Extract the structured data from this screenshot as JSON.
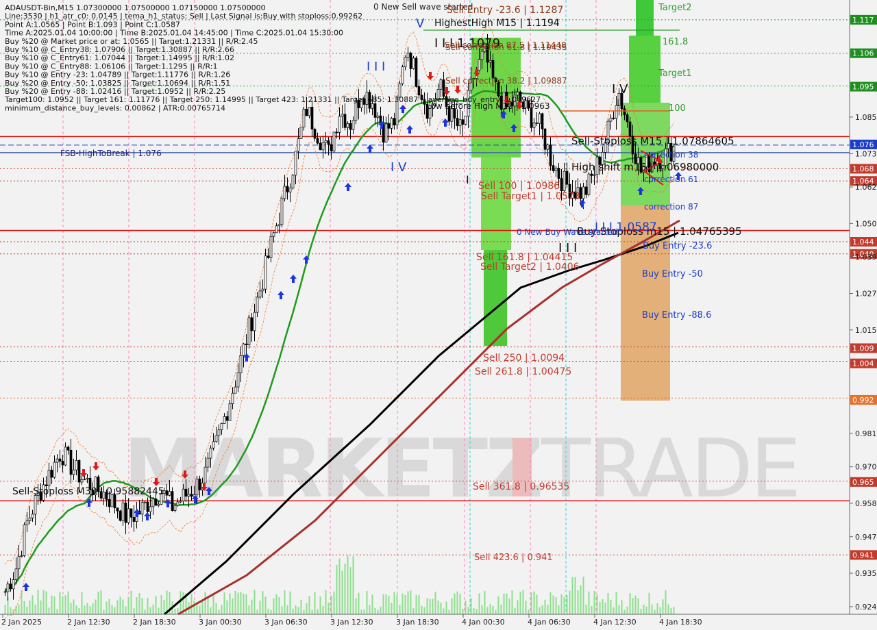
{
  "header": {
    "lines": [
      "ADAUSDT-Bin,M15  1.07300000 1.07500000 1.07150000 1.07500000",
      "Line:3530 | h1_atr_c0: 0.0145 | tema_h1_status: Sell | Last Signal is:Buy with stoploss:0.99262",
      "Point A:1.0565 | Point B:1.093 | Point C:1.0587",
      "Time A:2025.01.04 10:00:00 | Time B:2025.01.04 14:45:00 | Time C:2025.01.04 15:30:00",
      "Buy %20 @ Market price or at: 1.0565 || Target:1.21331 || R/R:2.45",
      "Buy %10 @ C_Entry38: 1.07906 || Target:1.30887 || R/R:2.66",
      "Buy %10 @ C_Entry61: 1.07044 || Target:1.14995 || R/R:1.02",
      "Buy %10 @ C_Entry88: 1.06106 || Target:1.1295 || R/R:1",
      "Buy %10 @ Entry -23: 1.04789 || Target:1.11776 || R/R:1.26",
      "Buy %20 @ Entry -50: 1.03825 || Target:1.10694 || R/R:1.51",
      "Buy %20 @ Entry -88: 1.02416 || Target:1.0952 || R/R:2.25",
      "Target100: 1.0952 || Target 161: 1.11776 || Target 250: 1.14995 || Target 423: 1.21331 || Target 685: 1.30887 || average_buy_entry: 1.049627",
      "minimum_distance_buy_levels: 0.00862 | ATR:0.00765714"
    ]
  },
  "watermark": {
    "left": "MARKETZ",
    "right": "TRADE"
  },
  "chart_data": {
    "type": "candlestick",
    "symbol": "ADAUSDT-Bin",
    "timeframe": "M15",
    "ylim": [
      0.9215,
      1.1235
    ],
    "y_ticks": [
      "1.117",
      "1.106",
      "1.095",
      "1.085",
      "1.076",
      "1.073",
      "1.068",
      "1.064",
      "1.062",
      "1.050",
      "1.044",
      "1.040",
      "1.039",
      "1.027",
      "1.015",
      "1.009",
      "1.004",
      "0.992",
      "0.981",
      "0.970",
      "0.965",
      "0.958",
      "0.947",
      "0.941",
      "0.935",
      "0.924"
    ],
    "highlighted_ticks": [
      {
        "label": "1.117",
        "color": "#1e8f1e"
      },
      {
        "label": "1.106",
        "color": "#1e8f1e"
      },
      {
        "label": "1.095",
        "color": "#1e8f1e"
      },
      {
        "label": "1.076",
        "color": "#1a3ecc"
      },
      {
        "label": "1.068",
        "color": "#c23b2c"
      },
      {
        "label": "1.064",
        "color": "#c23b2c"
      },
      {
        "label": "1.044",
        "color": "#c23b2c"
      },
      {
        "label": "1.040",
        "color": "#c23b2c"
      },
      {
        "label": "1.009",
        "color": "#c23b2c"
      },
      {
        "label": "1.004",
        "color": "#c23b2c"
      },
      {
        "label": "0.992",
        "color": "#e8702a"
      },
      {
        "label": "0.965",
        "color": "#c23b2c"
      },
      {
        "label": "0.941",
        "color": "#c23b2c"
      }
    ],
    "x_ticks": [
      "2 Jan 2025",
      "2 Jan 12:30",
      "2 Jan 18:30",
      "3 Jan 00:30",
      "3 Jan 06:30",
      "3 Jan 12:30",
      "3 Jan 18:30",
      "4 Jan 00:30",
      "4 Jan 06:30",
      "4 Jan 12:30",
      "4 Jan 18:30"
    ],
    "price_path": [
      0.929,
      0.937,
      0.952,
      0.961,
      0.968,
      0.975,
      0.97,
      0.966,
      0.963,
      0.961,
      0.957,
      0.953,
      0.955,
      0.959,
      0.962,
      0.957,
      0.96,
      0.963,
      0.968,
      0.978,
      0.99,
      1.003,
      1.017,
      1.03,
      1.045,
      1.058,
      1.071,
      1.088,
      1.08,
      1.073,
      1.087,
      1.083,
      1.094,
      1.09,
      1.08,
      1.084,
      1.109,
      1.097,
      1.087,
      1.095,
      1.085,
      1.08,
      1.098,
      1.106,
      1.094,
      1.088,
      1.091,
      1.086,
      1.082,
      1.071,
      1.064,
      1.061,
      1.06,
      1.068,
      1.079,
      1.094,
      1.081,
      1.067,
      1.071,
      1.072,
      1.075
    ],
    "horizontal_levels": [
      {
        "price": 1.117,
        "color": "#2e9e2e",
        "style": "dotted"
      },
      {
        "price": 1.106,
        "color": "#2e9e2e",
        "style": "dotted"
      },
      {
        "price": 1.0952,
        "color": "#2e9e2e",
        "style": "dotted"
      },
      {
        "price": 1.0786,
        "color": "#dd1111",
        "style": "solid"
      },
      {
        "price": 1.0758,
        "color": "#1a3ecc",
        "style": "dashed"
      },
      {
        "price": 1.0733,
        "color": "#4466aa",
        "style": "solid"
      },
      {
        "price": 1.068,
        "color": "#c23b2c",
        "style": "dotted"
      },
      {
        "price": 1.064,
        "color": "#c23b2c",
        "style": "dotted"
      },
      {
        "price": 1.0477,
        "color": "#dd1111",
        "style": "solid"
      },
      {
        "price": 1.044,
        "color": "#c23b2c",
        "style": "dotted"
      },
      {
        "price": 1.04,
        "color": "#c23b2c",
        "style": "dotted"
      },
      {
        "price": 1.0094,
        "color": "#c23b2c",
        "style": "dotted"
      },
      {
        "price": 1.0047,
        "color": "#c23b2c",
        "style": "dotted"
      },
      {
        "price": 0.9926,
        "color": "#e8702a",
        "style": "dotted"
      },
      {
        "price": 0.9653,
        "color": "#c23b2c",
        "style": "dotted"
      },
      {
        "price": 0.9588,
        "color": "#dd1111",
        "style": "solid"
      },
      {
        "price": 0.941,
        "color": "#c23b2c",
        "style": "dotted"
      }
    ],
    "labels": [
      {
        "text": "0 New Sell wave started",
        "color": "#222222"
      },
      {
        "text": "Sell Entry -23.6 | 1.1287",
        "color": "#8b3a1a"
      },
      {
        "text": "HighestHigh   M15 | 1.1194",
        "color": "#111111"
      },
      {
        "text": "I I I 1.1079",
        "color": "#111111"
      },
      {
        "text": "Sell correction 87.5 | 1.11448",
        "color": "#8b3a1a"
      },
      {
        "text": "Sell correction 61.8 | 1.10435",
        "color": "#8b3a1a"
      },
      {
        "text": "Sell correction 38.2 | 1.09887",
        "color": "#8b3a1a"
      },
      {
        "text": "Low before High   M15 | 1.0963",
        "color": "#111111"
      },
      {
        "text": "Sell 100 | 1.0986",
        "color": "#c23b2c"
      },
      {
        "text": "Sell Target1 | 1.0573",
        "color": "#c23b2c"
      },
      {
        "text": "Sell 161.8 | 1.04415",
        "color": "#c23b2c"
      },
      {
        "text": "Sell Target2 | 1.0406",
        "color": "#c23b2c"
      },
      {
        "text": "Sell 250 | 1.0094",
        "color": "#c23b2c"
      },
      {
        "text": "Sell  261.8 | 1.00475",
        "color": "#c23b2c"
      },
      {
        "text": "Sell  361.8 | 0.96535",
        "color": "#c23b2c"
      },
      {
        "text": "Sell  423.6 | 0.941",
        "color": "#c23b2c"
      },
      {
        "text": "Sell-Stoploss M15 | 1.07864605",
        "color": "#111111"
      },
      {
        "text": "High shift m15 | 1.06980000",
        "color": "#111111"
      },
      {
        "text": "Buy-Stoploss m15 | 1.04765395",
        "color": "#111111"
      },
      {
        "text": "Sell-Stoploss M30 | 0.95882445",
        "color": "#111111"
      },
      {
        "text": "FSB-HighToBreak | 1.076",
        "color": "#1a1a7a"
      },
      {
        "text": "0 New Buy Wave started",
        "color": "#1a3ecc"
      },
      {
        "text": "I I I 1.0587",
        "color": "#1a3ecc"
      },
      {
        "text": "correction 38",
        "color": "#1a3ecc"
      },
      {
        "text": "correction 61",
        "color": "#1a3ecc"
      },
      {
        "text": "correction 87",
        "color": "#1a3ecc"
      },
      {
        "text": "Buy Entry -23.6",
        "color": "#1a3ecc"
      },
      {
        "text": "Buy Entry -50",
        "color": "#1a3ecc"
      },
      {
        "text": "Buy Entry -88.6",
        "color": "#1a3ecc"
      },
      {
        "text": "Target2",
        "color": "#2e9e2e"
      },
      {
        "text": "161.8",
        "color": "#2e9e2e"
      },
      {
        "text": "Target1",
        "color": "#2e9e2e"
      },
      {
        "text": "100",
        "color": "#2e9e2e"
      }
    ],
    "wave_labels": [
      "V",
      "I I I",
      "I V",
      "I",
      "I I I",
      "I V",
      "I"
    ],
    "series": [
      {
        "name": "",
        "color": "#1e9a1e"
      },
      {
        "name": "",
        "color": "#000000"
      },
      {
        "name": "",
        "color": "#a8302a"
      }
    ],
    "grid": false
  }
}
